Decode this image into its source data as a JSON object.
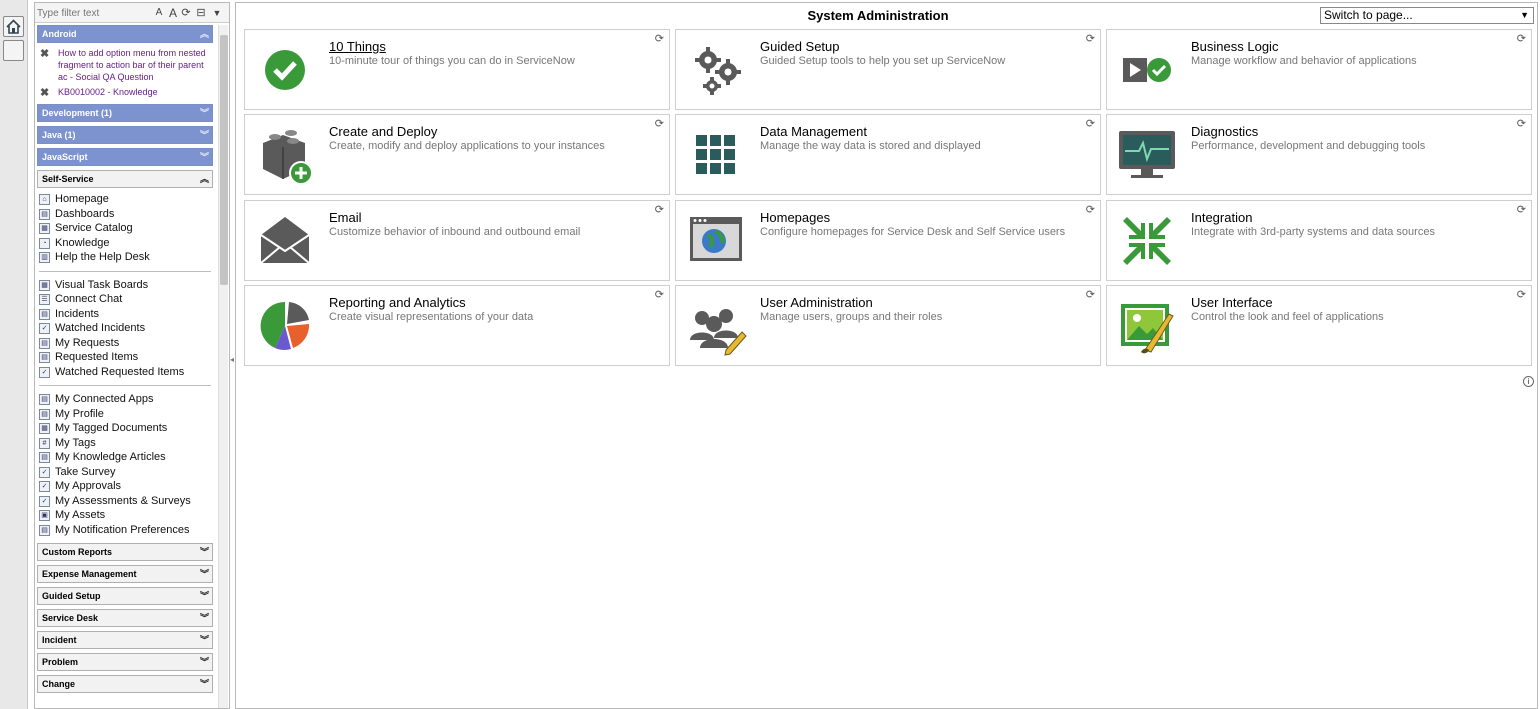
{
  "strip": {
    "home_icon": "home-icon"
  },
  "nav": {
    "filter_placeholder": "Type filter text",
    "filter_icons": [
      "A",
      "A",
      "⟳",
      "⊟",
      "▼"
    ],
    "android": {
      "label": "Android",
      "items": [
        "How to add option menu from nested fragment to action bar of their parent ac - Social QA Question",
        "KB0010002 - Knowledge"
      ]
    },
    "collapsed_top": [
      "Development (1)",
      "Java (1)",
      "JavaScript"
    ],
    "self_service": {
      "label": "Self-Service",
      "group1": [
        "Homepage",
        "Dashboards",
        "Service Catalog",
        "Knowledge",
        "Help the Help Desk"
      ],
      "group2": [
        "Visual Task Boards",
        "Connect Chat",
        "Incidents",
        "Watched Incidents",
        "My Requests",
        "Requested Items",
        "Watched Requested Items"
      ],
      "group3": [
        "My Connected Apps",
        "My Profile",
        "My Tagged Documents",
        "My Tags",
        "My Knowledge Articles",
        "Take Survey",
        "My Approvals",
        "My Assessments & Surveys",
        "My Assets",
        "My Notification Preferences"
      ]
    },
    "apps": [
      "Custom Reports",
      "Expense Management",
      "Guided Setup",
      "Service Desk",
      "Incident",
      "Problem",
      "Change"
    ]
  },
  "main": {
    "title": "System Administration",
    "switch_label": "Switch to page...",
    "tiles": [
      {
        "title": "10 Things",
        "desc": "10-minute tour of things you can do in ServiceNow",
        "icon": "checkmark-circle-icon"
      },
      {
        "title": "Guided Setup",
        "desc": "Guided Setup tools to help you set up ServiceNow",
        "icon": "gears-icon"
      },
      {
        "title": "Business Logic",
        "desc": "Manage workflow and behavior of applications",
        "icon": "play-check-icon"
      },
      {
        "title": "Create and Deploy",
        "desc": "Create, modify and deploy applications to your instances",
        "icon": "blocks-plus-icon"
      },
      {
        "title": "Data Management",
        "desc": "Manage the way data is stored and displayed",
        "icon": "grid-icon"
      },
      {
        "title": "Diagnostics",
        "desc": "Performance, development and debugging tools",
        "icon": "monitor-pulse-icon"
      },
      {
        "title": "Email",
        "desc": "Customize behavior of inbound and outbound email",
        "icon": "envelope-icon"
      },
      {
        "title": "Homepages",
        "desc": "Configure homepages for Service Desk and Self Service users",
        "icon": "browser-globe-icon"
      },
      {
        "title": "Integration",
        "desc": "Integrate with 3rd-party systems and data sources",
        "icon": "arrows-in-icon"
      },
      {
        "title": "Reporting and Analytics",
        "desc": "Create visual representations of your data",
        "icon": "pie-chart-icon"
      },
      {
        "title": "User Administration",
        "desc": "Manage users, groups and their roles",
        "icon": "users-pencil-icon"
      },
      {
        "title": "User Interface",
        "desc": "Control the look and feel of applications",
        "icon": "image-brush-icon"
      }
    ]
  },
  "colors": {
    "section_blue": "#7d93cf",
    "kb_purple": "#681f8a",
    "icon_green": "#3a9a3a",
    "icon_gray": "#5a5a5a",
    "icon_teal": "#2a5c5c"
  }
}
